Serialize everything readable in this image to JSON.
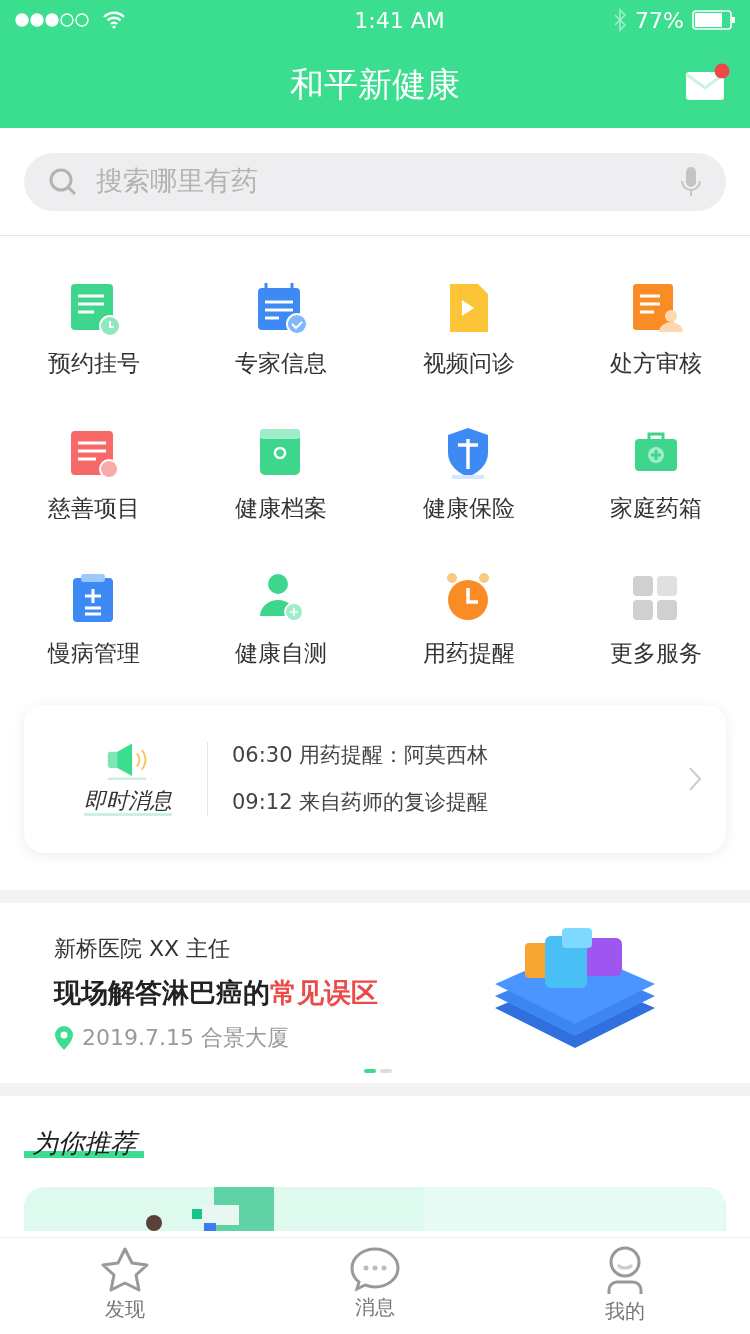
{
  "status_bar": {
    "time": "1:41 AM",
    "battery": "77%",
    "signal_dots": [
      {
        "filled": true
      },
      {
        "filled": true
      },
      {
        "filled": true
      },
      {
        "filled": false
      },
      {
        "filled": false
      }
    ]
  },
  "header": {
    "title": "和平新健康",
    "mail_unread": true
  },
  "search": {
    "placeholder": "搜索哪里有药"
  },
  "services": [
    {
      "label": "预约挂号"
    },
    {
      "label": "专家信息"
    },
    {
      "label": "视频问诊"
    },
    {
      "label": "处方审核"
    },
    {
      "label": "慈善项目"
    },
    {
      "label": "健康档案"
    },
    {
      "label": "健康保险"
    },
    {
      "label": "家庭药箱"
    },
    {
      "label": "慢病管理"
    },
    {
      "label": "健康自测"
    },
    {
      "label": "用药提醒"
    },
    {
      "label": "更多服务"
    }
  ],
  "messages": {
    "title": "即时消息",
    "items": [
      {
        "time": "06:30",
        "text": "用药提醒：阿莫西林"
      },
      {
        "time": "09:12",
        "text": "来自药师的复诊提醒"
      }
    ]
  },
  "banner": {
    "subtitle": "新桥医院 XX 主任",
    "headline": "现场解答淋巴癌的",
    "headline_highlight": "常见误区",
    "location": "2019.7.15 合景大厦",
    "pager": [
      {
        "selected": true
      },
      {
        "selected": false
      }
    ]
  },
  "recommend": {
    "title": "为你推荐"
  },
  "tab_bar": [
    {
      "label": "发现"
    },
    {
      "label": "消息"
    },
    {
      "label": "我的"
    }
  ]
}
